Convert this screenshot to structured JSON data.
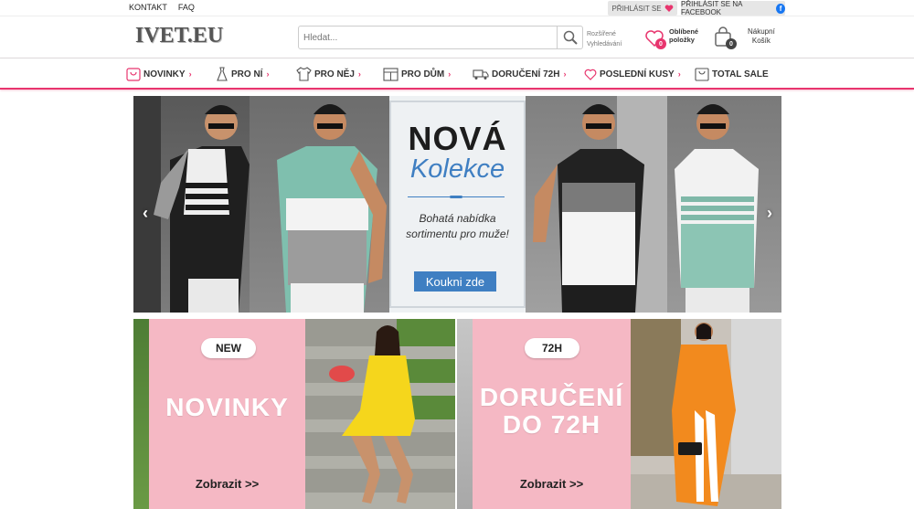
{
  "topbar": {
    "links": [
      "KONTAKT",
      "FAQ"
    ],
    "login_label": "PŘIHLÁSIT SE",
    "facebook_label": "PŘIHLÁSIT SE NA FACEBOOK"
  },
  "header": {
    "logo": "IVET.EU",
    "search_placeholder": "Hledat...",
    "advanced_search": [
      "Rozšířené",
      "Vyhledávání"
    ],
    "favorites_label": [
      "Oblíbené",
      "položky"
    ],
    "favorites_count": "0",
    "cart_label": [
      "Nákupní",
      "Košík"
    ],
    "cart_count": "0"
  },
  "nav": {
    "items": [
      {
        "label": "NOVINKY",
        "icon": "gift-icon"
      },
      {
        "label": "PRO NÍ",
        "icon": "dress-icon"
      },
      {
        "label": "PRO NĚJ",
        "icon": "shirt-icon"
      },
      {
        "label": "PRO DŮM",
        "icon": "window-icon"
      },
      {
        "label": "DORUČENÍ 72H",
        "icon": "truck-icon"
      },
      {
        "label": "POSLEDNÍ KUSY",
        "icon": "heart-icon"
      },
      {
        "label": "TOTAL SALE",
        "icon": "bag-icon"
      }
    ]
  },
  "banner": {
    "title": "NOVÁ",
    "subtitle": "Kolekce",
    "text_line1": "Bohatá nabídka",
    "text_line2": "sortimentu pro muže!",
    "cta": "Koukni zde"
  },
  "tiles": [
    {
      "badge": "NEW",
      "title": "NOVINKY",
      "link": "Zobrazit >>"
    },
    {
      "badge": "72H",
      "title_line1": "DORUČENÍ",
      "title_line2": "DO 72H",
      "link": "Zobrazit >>"
    }
  ],
  "colors": {
    "accent": "#e8356e",
    "blue": "#3f7fc2",
    "pink_tile": "#f5b8c4",
    "facebook": "#1877f2"
  }
}
